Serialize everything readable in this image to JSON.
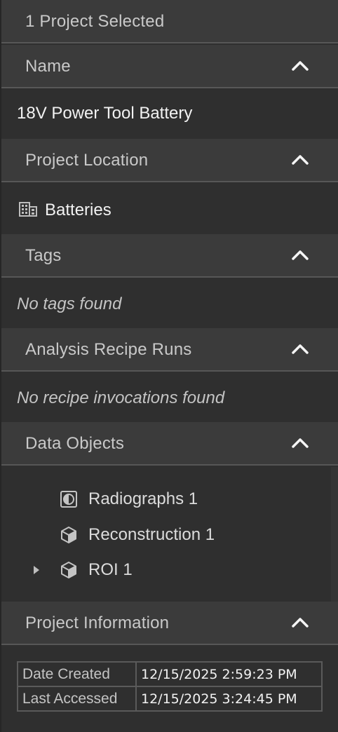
{
  "header": {
    "selection_summary": "1 Project Selected"
  },
  "sections": {
    "name": {
      "title": "Name",
      "value": "18V Power Tool Battery"
    },
    "location": {
      "title": "Project Location",
      "value": "Batteries",
      "icon": "building-icon"
    },
    "tags": {
      "title": "Tags",
      "empty": "No tags found"
    },
    "recipes": {
      "title": "Analysis Recipe Runs",
      "empty": "No recipe invocations found"
    },
    "data_objects": {
      "title": "Data Objects",
      "items": [
        {
          "label": "Radiographs 1",
          "icon": "radiograph-icon",
          "expandable": false
        },
        {
          "label": "Reconstruction 1",
          "icon": "cube-icon",
          "expandable": false
        },
        {
          "label": "ROI 1",
          "icon": "cube-icon",
          "expandable": true
        }
      ]
    },
    "info": {
      "title": "Project Information",
      "rows": [
        {
          "key": "Date Created",
          "value": "12/15/2025 2:59:23 PM"
        },
        {
          "key": "Last Accessed",
          "value": "12/15/2025 3:24:45 PM"
        }
      ]
    }
  },
  "colors": {
    "header_bg": "#3b3b3b",
    "panel_bg": "#2f2f2f",
    "divider": "#575757"
  }
}
